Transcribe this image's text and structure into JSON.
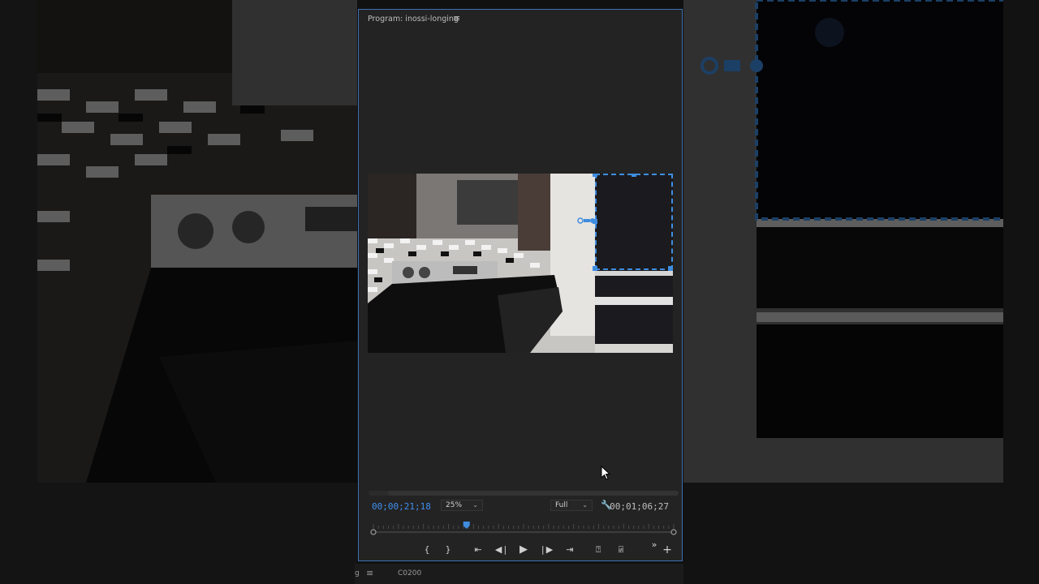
{
  "monitor": {
    "title": "Program: inossi-longing",
    "menu_icon": "hamburger-icon",
    "current_timecode": "00;00;21;18",
    "duration_timecode": "00;01;06;27",
    "zoom": {
      "selected": "25%"
    },
    "resolution": {
      "selected": "Full"
    },
    "playhead_progress": 0.31,
    "icons": {
      "settings": "wrench-icon",
      "mark_in": "mark-in-icon",
      "mark_out": "mark-out-icon",
      "go_to_in": "go-to-in-icon",
      "step_back": "step-back-icon",
      "play": "play-icon",
      "step_forward": "step-forward-icon",
      "go_to_out": "go-to-out-icon",
      "lift": "lift-icon",
      "extract": "extract-icon",
      "more": "chevron-double-right-icon",
      "add": "plus-icon"
    }
  },
  "bottom_bar": {
    "tab_partial": "g",
    "menu_icon": "hamburger-icon",
    "clip_name": "C0200"
  },
  "colors": {
    "accent": "#3e8de0",
    "timecode_current": "#3f8ff0",
    "panel_bg": "#232323",
    "panel_border": "#3d6fb6"
  }
}
